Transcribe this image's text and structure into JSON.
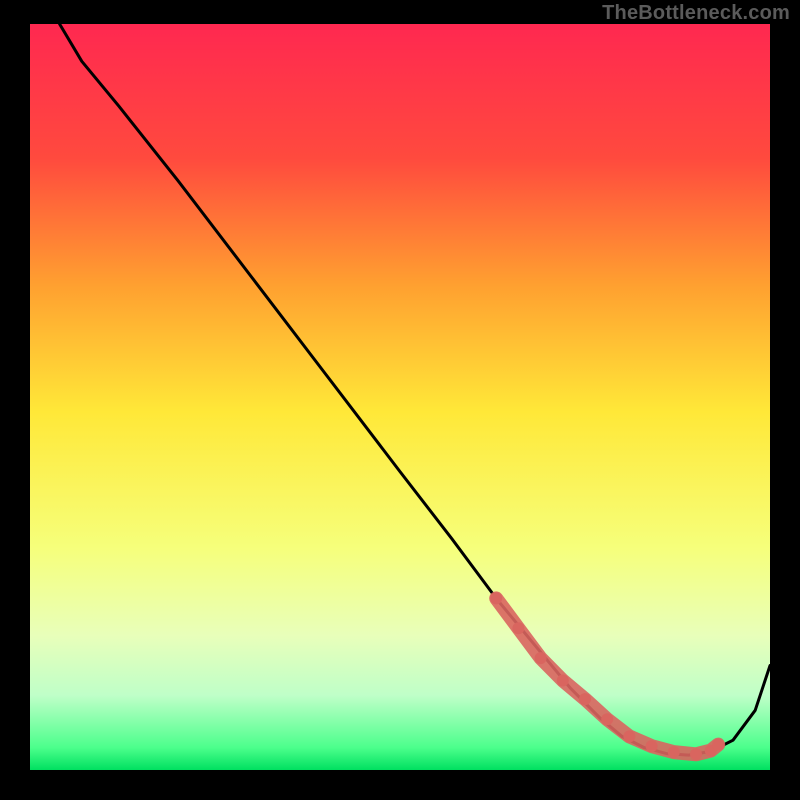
{
  "watermark": "TheBottleneck.com",
  "chart_data": {
    "type": "line",
    "title": "",
    "xlabel": "",
    "ylabel": "",
    "xlim": [
      0,
      100
    ],
    "ylim": [
      0,
      100
    ],
    "grid": false,
    "legend": false,
    "background_gradient": {
      "top": "#ff2850",
      "upper_mid": "#ffa030",
      "mid": "#ffe838",
      "lower_mid": "#f6ff7a",
      "lower": "#bfffc8",
      "bottom": "#00e060"
    },
    "series": [
      {
        "name": "curve",
        "stroke": "#000000",
        "x": [
          4,
          7,
          12,
          20,
          30,
          40,
          50,
          57,
          63,
          68,
          73,
          77,
          80,
          83,
          86,
          89,
          92,
          95,
          98,
          100
        ],
        "y": [
          100,
          95,
          89,
          79,
          66,
          53,
          40,
          31,
          23,
          17,
          11,
          7,
          4.5,
          3,
          2.2,
          2,
          2.5,
          4,
          8,
          14
        ]
      },
      {
        "name": "trough-markers",
        "stroke": "#d9655f",
        "marker": true,
        "x": [
          63,
          66,
          69,
          72,
          75,
          78,
          81,
          84,
          87,
          90,
          92,
          93
        ],
        "y": [
          23,
          19,
          15,
          12,
          9.5,
          6.8,
          4.5,
          3.2,
          2.4,
          2.1,
          2.6,
          3.4
        ]
      }
    ]
  }
}
